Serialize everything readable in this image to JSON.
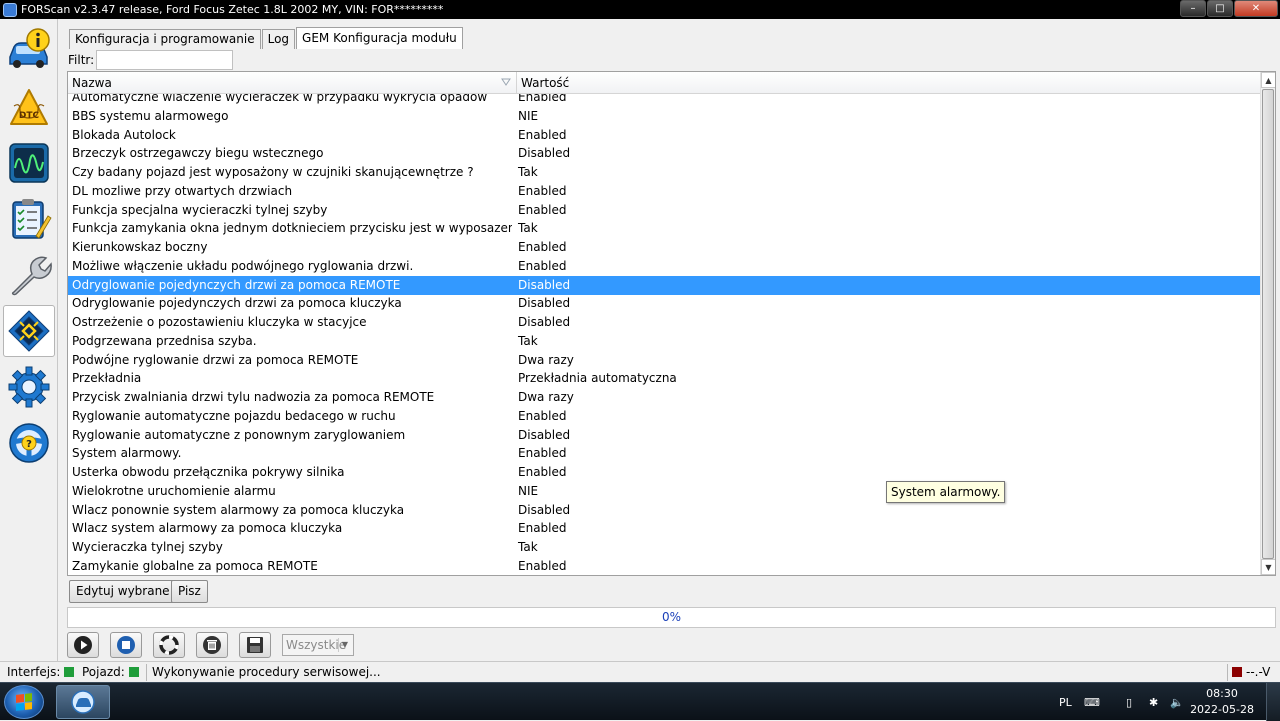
{
  "window": {
    "title": "FORScan v2.3.47 release, Ford Focus Zetec 1.8L 2002 MY, VIN: FOR*********",
    "min_label": "–",
    "max_label": "□",
    "close_label": "✕"
  },
  "sidebar": {
    "items": [
      {
        "name": "info",
        "icon": "car-info-icon"
      },
      {
        "name": "dtc",
        "icon": "dtc-icon",
        "label": "DTC"
      },
      {
        "name": "oscilloscope",
        "icon": "oscilloscope-icon"
      },
      {
        "name": "tests",
        "icon": "checklist-icon"
      },
      {
        "name": "service",
        "icon": "wrench-icon"
      },
      {
        "name": "configuration",
        "icon": "module-chip-icon",
        "active": true
      },
      {
        "name": "settings",
        "icon": "gear-icon"
      },
      {
        "name": "help",
        "icon": "help-wheel-icon"
      }
    ]
  },
  "tabs": [
    {
      "label": "Konfiguracja i programowanie"
    },
    {
      "label": "Log"
    },
    {
      "label": "GEM Konfiguracja modułu",
      "active": true
    }
  ],
  "filter": {
    "label": "Filtr:",
    "value": "",
    "placeholder": ""
  },
  "grid": {
    "columns": {
      "name": "Nazwa",
      "value": "Wartość"
    },
    "selected_index": 10,
    "rows": [
      {
        "name": "Automatyczne wlaczenie wycieraczek w przypadku wykrycia opadów",
        "value": "Enabled"
      },
      {
        "name": "BBS systemu alarmowego",
        "value": "NIE"
      },
      {
        "name": "Blokada Autolock",
        "value": "Enabled"
      },
      {
        "name": "Brzeczyk ostrzegawczy biegu wstecznego",
        "value": "Disabled"
      },
      {
        "name": "Czy badany pojazd jest wyposażony w czujniki skanującewnętrze ?",
        "value": "Tak"
      },
      {
        "name": "DL mozliwe przy otwartych drzwiach",
        "value": "Enabled"
      },
      {
        "name": "Funkcja specjalna wycieraczki tylnej szyby",
        "value": "Enabled"
      },
      {
        "name": "Funkcja zamykania okna jednym dotknieciem przycisku jest w wyposazeniu",
        "value": "Tak"
      },
      {
        "name": "Kierunkowskaz boczny",
        "value": "Enabled"
      },
      {
        "name": "Możliwe włączenie układu podwójnego ryglowania drzwi.",
        "value": "Enabled"
      },
      {
        "name": "Odryglowanie pojedynczych drzwi za pomoca REMOTE",
        "value": "Disabled"
      },
      {
        "name": "Odryglowanie pojedynczych drzwi za pomoca kluczyka",
        "value": "Disabled"
      },
      {
        "name": "Ostrzeżenie o pozostawieniu kluczyka w stacyjce",
        "value": "Disabled"
      },
      {
        "name": "Podgrzewana przednisa szyba.",
        "value": "Tak"
      },
      {
        "name": "Podwójne ryglowanie drzwi za pomoca REMOTE",
        "value": "Dwa razy"
      },
      {
        "name": "Przekładnia",
        "value": "Przekładnia automatyczna"
      },
      {
        "name": "Przycisk zwalniania drzwi tylu nadwozia za pomoca REMOTE",
        "value": "Dwa razy"
      },
      {
        "name": "Ryglowanie automatyczne pojazdu bedacego w ruchu",
        "value": "Enabled"
      },
      {
        "name": "Ryglowanie automatyczne z ponownym zaryglowaniem",
        "value": "Disabled"
      },
      {
        "name": "System alarmowy.",
        "value": "Enabled"
      },
      {
        "name": "Usterka obwodu przełącznika pokrywy silnika",
        "value": "Enabled"
      },
      {
        "name": "Wielokrotne uruchomienie alarmu",
        "value": "NIE"
      },
      {
        "name": "Wlacz ponownie system alarmowy za pomoca kluczyka",
        "value": "Disabled"
      },
      {
        "name": "Wlacz system alarmowy za pomoca kluczyka",
        "value": "Enabled"
      },
      {
        "name": "Wycieraczka tylnej szyby",
        "value": "Tak"
      },
      {
        "name": "Zamykanie globalne za pomoca REMOTE",
        "value": "Enabled"
      }
    ]
  },
  "tooltip": "System alarmowy.",
  "actions": {
    "edit_label": "Edytuj wybrane",
    "write_label": "Pisz"
  },
  "progress": {
    "label": "0%",
    "value": 0
  },
  "toolbar": {
    "buttons": [
      {
        "name": "play-button",
        "icon": "play-icon"
      },
      {
        "name": "stop-button",
        "icon": "stop-icon"
      },
      {
        "name": "lifebuoy-button",
        "icon": "lifebuoy-icon"
      },
      {
        "name": "trash-button",
        "icon": "trash-icon"
      },
      {
        "name": "save-button",
        "icon": "floppy-disk-icon"
      }
    ],
    "filter_select": "Wszystkie"
  },
  "status": {
    "interface_label": "Interfejs:",
    "vehicle_label": "Pojazd:",
    "message": "Wykonywanie procedury serwisowej...",
    "voltage": "--.-V",
    "interface_color": "#1f9d3a",
    "vehicle_color": "#1f9d3a",
    "voltage_color": "#8b0000"
  },
  "taskbar": {
    "language": "PL",
    "time": "08:30",
    "date": "2022-05-28"
  }
}
